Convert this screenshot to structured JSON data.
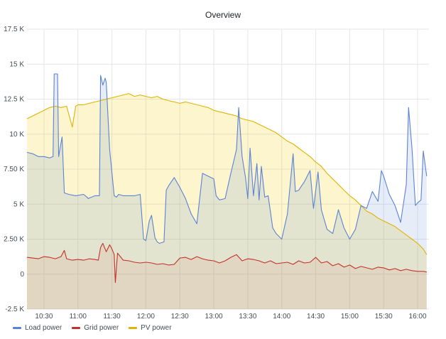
{
  "panel": {
    "title": "Overview"
  },
  "chart_data": {
    "type": "line",
    "title": "Overview",
    "xlabel": "",
    "ylabel": "",
    "ylim": [
      -2500,
      17500
    ],
    "xlim": [
      "10:15",
      "16:10"
    ],
    "y_ticks": [
      "-2.5 K",
      "0",
      "2.50 K",
      "5 K",
      "7.50 K",
      "10 K",
      "12.5 K",
      "15 K",
      "17.5 K"
    ],
    "y_tick_values": [
      -2500,
      0,
      2500,
      5000,
      7500,
      10000,
      12500,
      15000,
      17500
    ],
    "x_ticks": [
      "10:30",
      "11:00",
      "11:30",
      "12:00",
      "12:30",
      "13:00",
      "13:30",
      "14:00",
      "14:30",
      "15:00",
      "15:30",
      "16:00"
    ],
    "grid": true,
    "legend_position": "bottom-left",
    "x_minutes_note_unused": null,
    "series": [
      {
        "name": "Load power",
        "color": "#5a83d6",
        "fill": "rgba(90,131,214,0.15)",
        "x": [
          "10:15",
          "10:20",
          "10:25",
          "10:30",
          "10:35",
          "10:38",
          "10:39",
          "10:42",
          "10:43",
          "10:46",
          "10:48",
          "10:52",
          "10:58",
          "11:05",
          "11:08",
          "11:09",
          "11:15",
          "11:19",
          "11:20",
          "11:22",
          "11:24",
          "11:25",
          "11:28",
          "11:32",
          "11:34",
          "11:36",
          "11:40",
          "11:50",
          "11:55",
          "11:58",
          "12:00",
          "12:03",
          "12:05",
          "12:08",
          "12:10",
          "12:12",
          "12:16",
          "12:18",
          "12:20",
          "12:25",
          "12:30",
          "12:35",
          "12:40",
          "12:45",
          "12:50",
          "12:55",
          "13:00",
          "13:02",
          "13:05",
          "13:10",
          "13:15",
          "13:20",
          "13:22",
          "13:25",
          "13:28",
          "13:30",
          "13:32",
          "13:35",
          "13:38",
          "13:40",
          "13:42",
          "13:45",
          "13:48",
          "13:52",
          "13:55",
          "14:00",
          "14:05",
          "14:10",
          "14:12",
          "14:15",
          "14:20",
          "14:25",
          "14:28",
          "14:30",
          "14:32",
          "14:35",
          "14:40",
          "14:45",
          "14:50",
          "14:55",
          "15:00",
          "15:05",
          "15:10",
          "15:15",
          "15:20",
          "15:25",
          "15:28",
          "15:30",
          "15:35",
          "15:40",
          "15:45",
          "15:50",
          "15:52",
          "15:55",
          "15:58",
          "16:00",
          "16:03",
          "16:05",
          "16:08"
        ],
        "values": [
          8700,
          8600,
          8400,
          8400,
          8300,
          8400,
          14300,
          14300,
          8400,
          9800,
          5800,
          5700,
          5600,
          5700,
          5500,
          5400,
          5600,
          5600,
          14200,
          13500,
          14000,
          13700,
          8900,
          5600,
          5500,
          5700,
          5600,
          5600,
          5700,
          2500,
          2400,
          3800,
          4200,
          2600,
          2300,
          2200,
          2300,
          6000,
          6300,
          6900,
          6200,
          5400,
          4300,
          3600,
          7200,
          7000,
          6800,
          5600,
          5300,
          5400,
          7200,
          8900,
          11900,
          8400,
          6900,
          5400,
          9000,
          5600,
          7900,
          5300,
          7700,
          5500,
          5600,
          3300,
          2900,
          2500,
          4300,
          8600,
          5900,
          6000,
          6600,
          7400,
          4700,
          6000,
          7300,
          4600,
          3200,
          2900,
          4600,
          3300,
          2500,
          3200,
          4900,
          4700,
          5900,
          5200,
          7400,
          7000,
          5700,
          4900,
          3700,
          6400,
          11900,
          9000,
          4900,
          5100,
          5300,
          8800,
          7000
        ]
      },
      {
        "name": "Grid power",
        "color": "#c4312c",
        "fill": "rgba(196,49,44,0.08)",
        "x": [
          "10:15",
          "10:20",
          "10:25",
          "10:30",
          "10:35",
          "10:40",
          "10:45",
          "10:48",
          "10:50",
          "10:55",
          "11:00",
          "11:05",
          "11:10",
          "11:15",
          "11:18",
          "11:20",
          "11:22",
          "11:25",
          "11:28",
          "11:30",
          "11:32",
          "11:33",
          "11:35",
          "11:40",
          "11:45",
          "11:50",
          "11:55",
          "12:00",
          "12:05",
          "12:10",
          "12:15",
          "12:20",
          "12:25",
          "12:30",
          "12:35",
          "12:40",
          "12:45",
          "12:50",
          "12:55",
          "13:00",
          "13:05",
          "13:10",
          "13:15",
          "13:20",
          "13:25",
          "13:30",
          "13:35",
          "13:40",
          "13:45",
          "13:50",
          "13:55",
          "14:00",
          "14:05",
          "14:10",
          "14:15",
          "14:20",
          "14:25",
          "14:30",
          "14:35",
          "14:40",
          "14:45",
          "14:50",
          "14:55",
          "15:00",
          "15:05",
          "15:10",
          "15:15",
          "15:20",
          "15:25",
          "15:30",
          "15:35",
          "15:40",
          "15:45",
          "15:50",
          "15:55",
          "16:00",
          "16:05",
          "16:08"
        ],
        "values": [
          1200,
          1150,
          1100,
          1250,
          1200,
          1100,
          1250,
          1700,
          1100,
          1000,
          1050,
          1000,
          1100,
          1050,
          1000,
          1900,
          2200,
          1600,
          2100,
          1800,
          1400,
          -600,
          1500,
          1000,
          950,
          850,
          800,
          850,
          800,
          700,
          750,
          650,
          700,
          1150,
          1200,
          1050,
          1250,
          1100,
          1000,
          950,
          800,
          950,
          1200,
          1400,
          950,
          1100,
          1050,
          950,
          800,
          950,
          750,
          800,
          850,
          700,
          950,
          800,
          850,
          1200,
          800,
          900,
          600,
          750,
          500,
          650,
          400,
          550,
          450,
          350,
          500,
          450,
          300,
          400,
          250,
          350,
          250,
          200,
          200,
          150
        ]
      },
      {
        "name": "PV power",
        "color": "#e0b400",
        "fill": "rgba(242,204,12,0.20)",
        "x": [
          "10:15",
          "10:20",
          "10:25",
          "10:30",
          "10:35",
          "10:40",
          "10:45",
          "10:50",
          "10:55",
          "10:58",
          "11:00",
          "11:05",
          "11:10",
          "11:15",
          "11:20",
          "11:25",
          "11:30",
          "11:35",
          "11:40",
          "11:45",
          "11:50",
          "11:55",
          "12:00",
          "12:05",
          "12:10",
          "12:15",
          "12:20",
          "12:25",
          "12:30",
          "12:35",
          "12:40",
          "12:45",
          "12:50",
          "12:55",
          "13:00",
          "13:05",
          "13:10",
          "13:15",
          "13:20",
          "13:25",
          "13:30",
          "13:35",
          "13:40",
          "13:45",
          "13:50",
          "13:55",
          "14:00",
          "14:05",
          "14:10",
          "14:15",
          "14:20",
          "14:25",
          "14:30",
          "14:35",
          "14:40",
          "14:45",
          "14:50",
          "14:55",
          "15:00",
          "15:05",
          "15:10",
          "15:15",
          "15:20",
          "15:25",
          "15:30",
          "15:35",
          "15:40",
          "15:45",
          "15:50",
          "15:55",
          "16:00",
          "16:05",
          "16:08"
        ],
        "values": [
          11100,
          11300,
          11500,
          11700,
          11900,
          12000,
          11900,
          12000,
          10500,
          12000,
          12100,
          12100,
          12200,
          12300,
          12400,
          12500,
          12600,
          12700,
          12800,
          12900,
          12700,
          12800,
          12700,
          12600,
          12700,
          12500,
          12400,
          12300,
          12200,
          12300,
          12200,
          12100,
          12000,
          11900,
          11700,
          11600,
          11500,
          11400,
          11300,
          11100,
          11000,
          10900,
          10700,
          10500,
          10300,
          10100,
          9800,
          9500,
          9300,
          9000,
          8700,
          8400,
          8000,
          7700,
          7200,
          6800,
          6400,
          6000,
          5600,
          5300,
          4900,
          4500,
          4300,
          4000,
          3800,
          3600,
          3400,
          3100,
          2800,
          2500,
          2200,
          1800,
          1400
        ]
      }
    ]
  }
}
